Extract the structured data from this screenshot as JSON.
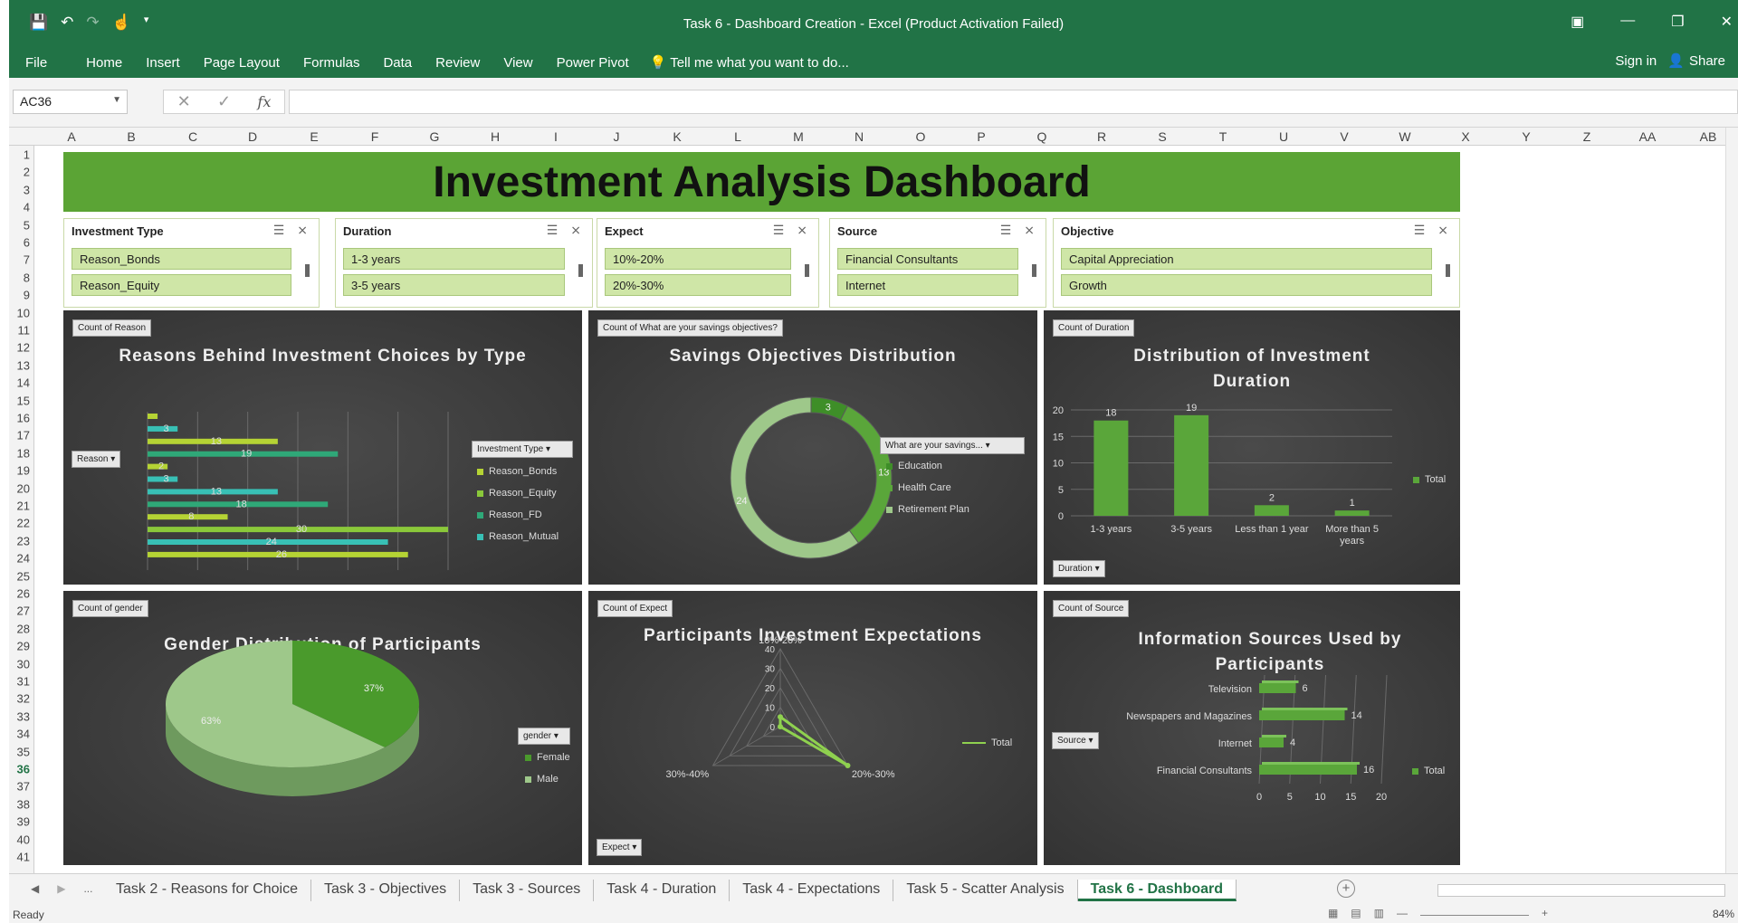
{
  "window": {
    "title": "Task 6 - Dashboard Creation - Excel (Product Activation Failed)"
  },
  "ribbon": {
    "tabs": [
      "File",
      "Home",
      "Insert",
      "Page Layout",
      "Formulas",
      "Data",
      "Review",
      "View",
      "Power Pivot"
    ],
    "tell_me": "Tell me what you want to do...",
    "sign_in": "Sign in",
    "share": "Share"
  },
  "formula_bar": {
    "name_box": "AC36",
    "value": ""
  },
  "columns": [
    "A",
    "B",
    "C",
    "D",
    "E",
    "F",
    "G",
    "H",
    "I",
    "J",
    "K",
    "L",
    "M",
    "N",
    "O",
    "P",
    "Q",
    "R",
    "S",
    "T",
    "U",
    "V",
    "W",
    "X",
    "Y",
    "Z",
    "AA",
    "AB"
  ],
  "rows": [
    "1",
    "2",
    "3",
    "4",
    "5",
    "6",
    "7",
    "8",
    "9",
    "10",
    "11",
    "12",
    "13",
    "14",
    "15",
    "16",
    "17",
    "18",
    "19",
    "20",
    "21",
    "22",
    "23",
    "24",
    "25",
    "26",
    "27",
    "28",
    "29",
    "30",
    "31",
    "32",
    "33",
    "34",
    "35",
    "36",
    "37",
    "38",
    "39",
    "40",
    "41"
  ],
  "selected_row": "36",
  "dashboard_title": "Investment Analysis Dashboard",
  "slicers": [
    {
      "title": "Investment Type",
      "items": [
        "Reason_Bonds",
        "Reason_Equity"
      ]
    },
    {
      "title": "Duration",
      "items": [
        "1-3 years",
        "3-5 years"
      ]
    },
    {
      "title": "Expect",
      "items": [
        "10%-20%",
        "20%-30%"
      ]
    },
    {
      "title": "Source",
      "items": [
        "Financial Consultants",
        "Internet"
      ]
    },
    {
      "title": "Objective",
      "items": [
        "Capital Appreciation",
        "Growth"
      ]
    }
  ],
  "panels": {
    "reasons": {
      "tag": "Count of Reason",
      "title": "Reasons Behind Investment Choices by Type",
      "filter": "Reason",
      "legend_filter": "Investment Type"
    },
    "objectives": {
      "tag": "Count of What are your savings objectives?",
      "title": "Savings Objectives Distribution",
      "legend_filter": "What are your savings..."
    },
    "duration": {
      "tag": "Count of Duration",
      "title": "Distribution of Investment Duration",
      "filter": "Duration"
    },
    "gender": {
      "tag": "Count of gender",
      "title": "Gender Distribution of Participants",
      "legend_filter": "gender"
    },
    "expect": {
      "tag": "Count of Expect",
      "title": "Participants Investment Expectations",
      "filter": "Expect"
    },
    "source": {
      "tag": "Count of Source",
      "title": "Information Sources Used by Participants",
      "filter": "Source"
    }
  },
  "chart_data": [
    {
      "type": "bar",
      "title": "Reasons Behind Investment Choices by Type",
      "orientation": "horizontal",
      "series_names": [
        "Reason_Bonds",
        "Reason_Equity",
        "Reason_FD",
        "Reason_Mutual"
      ],
      "colors": [
        "#b5d334",
        "#8ac83a",
        "#2fa878",
        "#38c0b5"
      ],
      "bars": [
        {
          "series": 0,
          "value": 1,
          "label": ""
        },
        {
          "series": 3,
          "value": 3,
          "label": "3"
        },
        {
          "series": 0,
          "value": 13,
          "label": "13"
        },
        {
          "series": 2,
          "value": 19,
          "label": "19"
        },
        {
          "series": 0,
          "value": 2,
          "label": "2"
        },
        {
          "series": 3,
          "value": 3,
          "label": "3"
        },
        {
          "series": 3,
          "value": 13,
          "label": "13"
        },
        {
          "series": 2,
          "value": 18,
          "label": "18"
        },
        {
          "series": 0,
          "value": 8,
          "label": "8"
        },
        {
          "series": 1,
          "value": 30,
          "label": "30"
        },
        {
          "series": 3,
          "value": 24,
          "label": "24"
        },
        {
          "series": 0,
          "value": 26,
          "label": "26"
        }
      ],
      "xlim": [
        0,
        30
      ]
    },
    {
      "type": "pie",
      "title": "Savings Objectives Distribution",
      "variant": "doughnut",
      "categories": [
        "Education",
        "Health Care",
        "Retirement Plan"
      ],
      "values": [
        3,
        13,
        24
      ],
      "colors": [
        "#3e8e28",
        "#5aa63a",
        "#9ec88a"
      ]
    },
    {
      "type": "bar",
      "title": "Distribution of Investment Duration",
      "categories": [
        "1-3 years",
        "3-5 years",
        "Less than 1 year",
        "More than 5 years"
      ],
      "series": [
        {
          "name": "Total",
          "values": [
            18,
            19,
            2,
            1
          ]
        }
      ],
      "ylim": [
        0,
        20
      ],
      "yticks": [
        0,
        5,
        10,
        15,
        20
      ],
      "grid": true,
      "color": "#5aa63a"
    },
    {
      "type": "pie",
      "title": "Gender Distribution of Participants",
      "categories": [
        "Female",
        "Male"
      ],
      "values": [
        37,
        63
      ],
      "labels": [
        "37%",
        "63%"
      ],
      "colors": [
        "#4a9a2c",
        "#9ec88a"
      ]
    },
    {
      "type": "line",
      "title": "Participants Investment Expectations",
      "variant": "radar",
      "categories": [
        "10%-20%",
        "20%-30%",
        "30%-40%"
      ],
      "series": [
        {
          "name": "Total",
          "values": [
            5,
            40,
            0
          ]
        }
      ],
      "ylim": [
        0,
        40
      ],
      "rticks": [
        0,
        10,
        20,
        30,
        40
      ],
      "color": "#8fd14f"
    },
    {
      "type": "bar",
      "title": "Information Sources Used by Participants",
      "orientation": "horizontal",
      "categories": [
        "Television",
        "Newspapers and Magazines",
        "Internet",
        "Financial Consultants"
      ],
      "series": [
        {
          "name": "Total",
          "values": [
            6,
            14,
            4,
            16
          ]
        }
      ],
      "xlim": [
        0,
        20
      ],
      "xticks": [
        0,
        5,
        10,
        15,
        20
      ],
      "color": "#5aa63a"
    }
  ],
  "sheet_tabs": [
    "Task 2 - Reasons for Choice",
    "Task 3 - Objectives",
    "Task 3 - Sources",
    "Task 4 - Duration",
    "Task 4 - Expectations",
    "Task 5 - Scatter Analysis",
    "Task 6 - Dashboard"
  ],
  "active_sheet": 6,
  "status": {
    "ready": "Ready",
    "zoom": "84%"
  }
}
